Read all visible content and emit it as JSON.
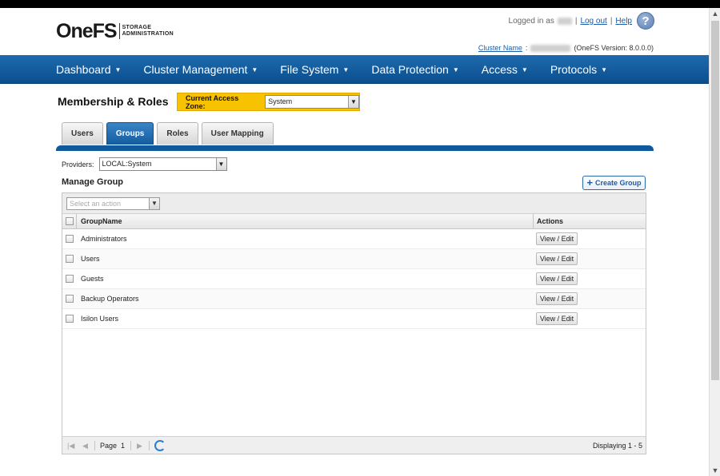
{
  "app": {
    "logo_main": "OneFS",
    "logo_tag_line1": "STORAGE",
    "logo_tag_line2": "ADMINISTRATION"
  },
  "userbar": {
    "logged_in_label": "Logged in as",
    "logout_label": "Log out",
    "help_label": "Help",
    "help_icon": "?"
  },
  "cluster": {
    "name_label": "Cluster Name",
    "version_text": "(OneFS Version: 8.0.0.0)"
  },
  "nav": {
    "items": [
      {
        "label": "Dashboard"
      },
      {
        "label": "Cluster Management"
      },
      {
        "label": "File System"
      },
      {
        "label": "Data Protection"
      },
      {
        "label": "Access"
      },
      {
        "label": "Protocols"
      }
    ]
  },
  "page": {
    "title": "Membership & Roles",
    "zone_label": "Current Access Zone:",
    "zone_value": "System"
  },
  "tabs": [
    {
      "label": "Users",
      "active": false
    },
    {
      "label": "Groups",
      "active": true
    },
    {
      "label": "Roles",
      "active": false
    },
    {
      "label": "User Mapping",
      "active": false
    }
  ],
  "providers": {
    "label": "Providers:",
    "value": "LOCAL:System"
  },
  "manage": {
    "title": "Manage Group",
    "create_label": "Create Group",
    "action_placeholder": "Select an action"
  },
  "grid": {
    "columns": [
      "GroupName",
      "Actions"
    ],
    "rows": [
      {
        "name": "Administrators",
        "action": "View / Edit"
      },
      {
        "name": "Users",
        "action": "View / Edit"
      },
      {
        "name": "Guests",
        "action": "View / Edit"
      },
      {
        "name": "Backup Operators",
        "action": "View / Edit"
      },
      {
        "name": "Isilon Users",
        "action": "View / Edit"
      }
    ],
    "page_label": "Page",
    "page_number": "1",
    "displaying": "Displaying 1 - 5"
  },
  "colors": {
    "nav_blue": "#0f5a9c",
    "zone_yellow": "#f7c300"
  }
}
